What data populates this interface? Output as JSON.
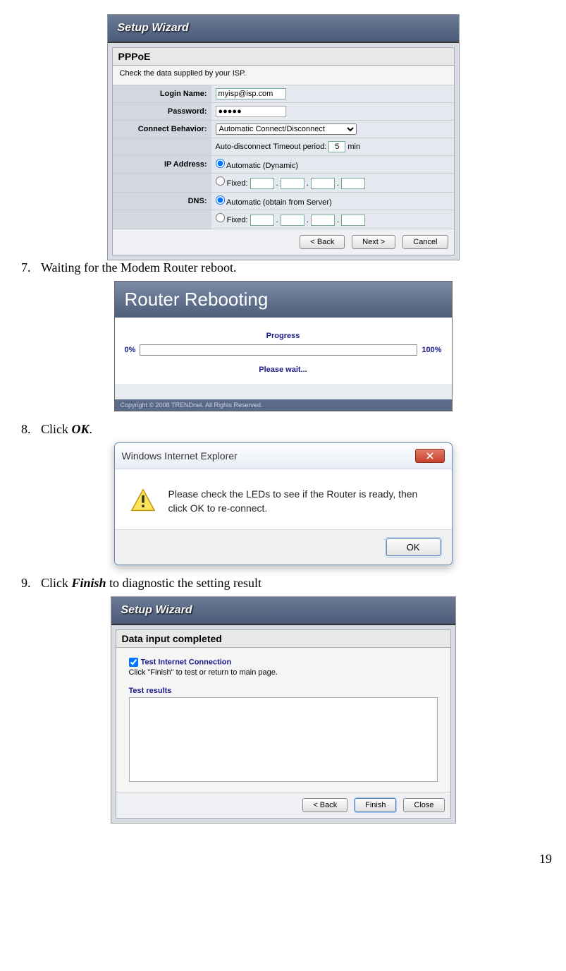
{
  "wizard1": {
    "title": "Setup Wizard",
    "section": "PPPoE",
    "desc": "Check the data supplied by your ISP.",
    "labels": {
      "login": "Login Name:",
      "password": "Password:",
      "connect": "Connect Behavior:",
      "timeout_pre": "Auto-disconnect Timeout period:",
      "timeout_unit": "min",
      "ip": "IP Address:",
      "dns": "DNS:",
      "auto_dyn": "Automatic (Dynamic)",
      "auto_srv": "Automatic (obtain from Server)",
      "fixed": "Fixed:"
    },
    "values": {
      "login": "myisp@isp.com",
      "password": "●●●●●",
      "connect": "Automatic Connect/Disconnect",
      "timeout": "5"
    },
    "buttons": {
      "back": "< Back",
      "next": "Next >",
      "cancel": "Cancel"
    }
  },
  "step7": {
    "num": "7.",
    "text": "Waiting for the Modem Router reboot."
  },
  "reboot": {
    "title": "Router Rebooting",
    "progress": "Progress",
    "pct0": "0%",
    "pct100": "100%",
    "wait": "Please wait...",
    "copyright": "Copyright © 2008 TRENDnet. All Rights Reserved."
  },
  "step8": {
    "num": "8.",
    "text_pre": "Click ",
    "ok": "OK",
    "text_post": "."
  },
  "iedialog": {
    "title": "Windows Internet Explorer",
    "msg": "Please check the LEDs to see if the Router is ready, then click OK to re-connect.",
    "ok": "OK"
  },
  "step9": {
    "num": "9.",
    "text_pre": "Click ",
    "finish": "Finish",
    "text_post": " to diagnostic the setting result"
  },
  "wizard2": {
    "title": "Setup Wizard",
    "section": "Data input completed",
    "test_chk": "Test Internet Connection",
    "desc": "Click \"Finish\" to test or return to main page.",
    "results_label": "Test results",
    "buttons": {
      "back": "< Back",
      "finish": "Finish",
      "close": "Close"
    }
  },
  "pagenum": "19"
}
